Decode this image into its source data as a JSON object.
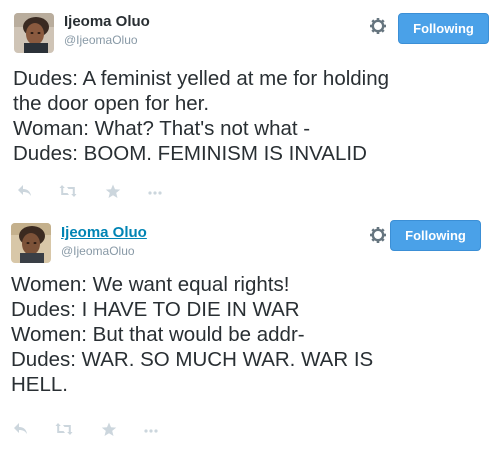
{
  "tweets": [
    {
      "author": {
        "name": "Ijeoma Oluo",
        "handle": "@IjeomaOluo"
      },
      "follow_label": "Following",
      "lines": [
        "Dudes: A feminist yelled at me for holding",
        "the door open for her.",
        "Woman: What? That's not what -",
        "Dudes: BOOM. FEMINISM IS INVALID"
      ]
    },
    {
      "author": {
        "name": "Ijeoma Oluo",
        "handle": "@IjeomaOluo"
      },
      "follow_label": "Following",
      "lines": [
        "Women: We want equal rights!",
        "Dudes: I HAVE TO DIE IN WAR",
        "Women: But that would be addr-",
        "Dudes: WAR. SO MUCH WAR. WAR IS",
        "HELL."
      ]
    }
  ],
  "colors": {
    "follow_button": "#4aa1e8",
    "link": "#0084b4",
    "muted": "#8899a6",
    "icon": "#ccd6dd"
  },
  "icons": [
    "gear-icon",
    "reply-icon",
    "retweet-icon",
    "favorite-icon",
    "more-icon"
  ]
}
